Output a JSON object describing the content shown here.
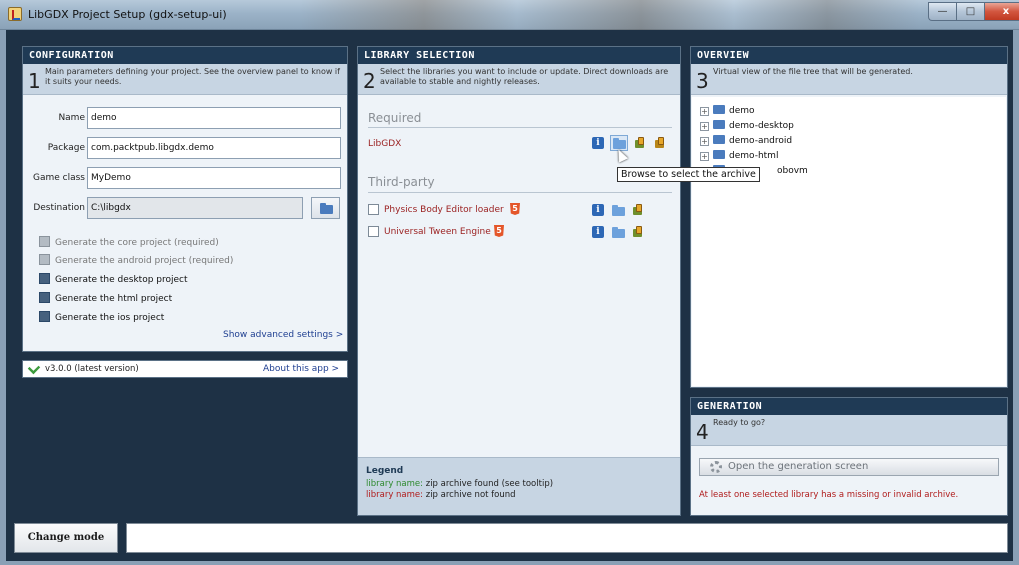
{
  "window": {
    "title": "LibGDX Project Setup (gdx-setup-ui)",
    "buttons": {
      "minimize": "—",
      "maximize": "□",
      "close": "x"
    }
  },
  "configuration": {
    "header": "CONFIGURATION",
    "step": "1",
    "description": "Main parameters defining your project. See the overview panel to know if it suits your needs.",
    "fields": {
      "name_label": "Name",
      "name_value": "demo",
      "package_label": "Package",
      "package_value": "com.packtpub.libgdx.demo",
      "game_class_label": "Game class",
      "game_class_value": "MyDemo",
      "destination_label": "Destination",
      "destination_value": "C:\\libgdx"
    },
    "options": [
      {
        "label": "Generate the core project (required)",
        "checked": true,
        "enabled": false
      },
      {
        "label": "Generate the android project (required)",
        "checked": true,
        "enabled": false
      },
      {
        "label": "Generate the desktop project",
        "checked": true,
        "enabled": true
      },
      {
        "label": "Generate the html project",
        "checked": true,
        "enabled": true
      },
      {
        "label": "Generate the ios project",
        "checked": true,
        "enabled": true
      }
    ],
    "advanced_link": "Show advanced settings >",
    "version": "v3.0.0 (latest version)",
    "about_link": "About this app >"
  },
  "library": {
    "header": "LIBRARY SELECTION",
    "step": "2",
    "description": "Select the libraries you want to include or update. Direct downloads are available to stable and nightly releases.",
    "required_title": "Required",
    "required": [
      {
        "name": "LibGDX"
      }
    ],
    "third_party_title": "Third-party",
    "third_party": [
      {
        "name": "Physics Body Editor loader",
        "html5": "5"
      },
      {
        "name": "Universal Tween Engine",
        "html5": "5"
      }
    ],
    "info_glyph": "i",
    "tooltip": "Browse to select the archive",
    "legend": {
      "title": "Legend",
      "found_name": "library name:",
      "found_text": " zip archive found (see tooltip)",
      "missing_name": "library name:",
      "missing_text": " zip archive not found"
    }
  },
  "overview": {
    "header": "OVERVIEW",
    "step": "3",
    "description": "Virtual view of the file tree that will be generated.",
    "tree": [
      "demo",
      "demo-desktop",
      "demo-android",
      "demo-html",
      "obovm"
    ],
    "expander": "+"
  },
  "generation": {
    "header": "GENERATION",
    "step": "4",
    "description": "Ready to go?",
    "button": "Open the generation screen",
    "error": "At least one selected library has a missing or invalid archive."
  },
  "footer": {
    "change_mode": "Change mode",
    "status": ""
  },
  "icons": {
    "app": "libgdx-app-icon",
    "browse": "folder-icon",
    "info": "info-icon",
    "download": "download-icon",
    "html5": "html5-icon",
    "check": "checkmark-icon",
    "gear": "gear-icon"
  },
  "colors": {
    "header_bg": "#1f3a55",
    "panel_bg": "#eef3f8",
    "subheader_bg": "#c7d5e3",
    "library_missing": "#9a1f1f",
    "legend_found": "#2e8a2e",
    "error": "#b01c1c"
  }
}
